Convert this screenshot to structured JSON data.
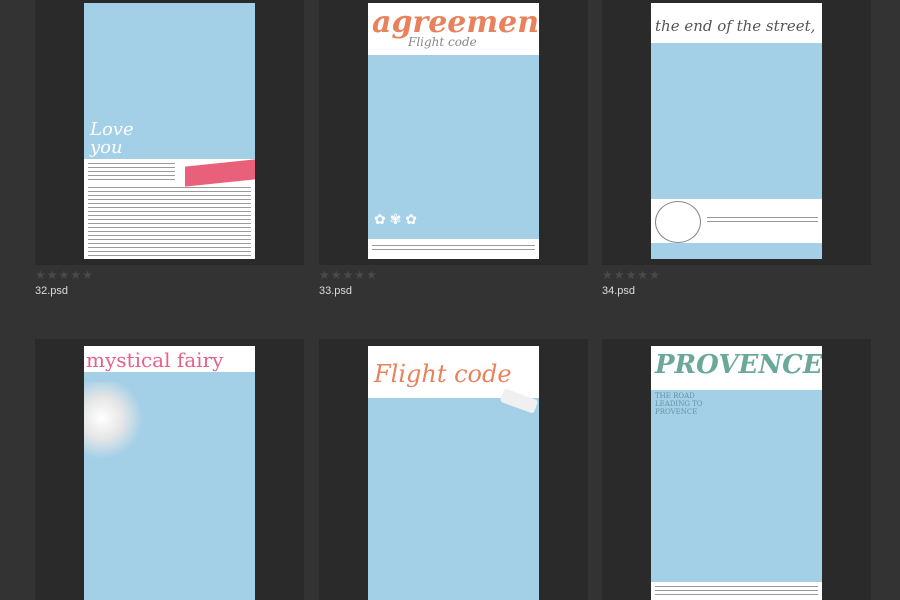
{
  "files": [
    {
      "name": "32.psd",
      "rating": 0
    },
    {
      "name": "33.psd",
      "rating": 0
    },
    {
      "name": "34.psd",
      "rating": 0
    },
    {
      "name": "",
      "rating": 0
    },
    {
      "name": "",
      "rating": 0
    },
    {
      "name": "",
      "rating": 0
    }
  ],
  "thumbnails": {
    "t32": {
      "title": "Love you",
      "banner_color": "#e8607a"
    },
    "t33": {
      "title": "agreement",
      "subtitle": "Flight code",
      "title_color": "#e8825c"
    },
    "t34": {
      "title": "the end of the street,",
      "title_color": "#555555"
    },
    "t35": {
      "title": "mystical fairy",
      "title_color": "#e8608a"
    },
    "t36": {
      "title": "Flight code",
      "title_color": "#e8825c"
    },
    "t37": {
      "title": "PROVENCE",
      "subtitle": "THE ROAD LEADING TO PROVENCE",
      "title_color": "#6aa89a"
    }
  },
  "colors": {
    "background": "#333333",
    "card": "#2a2a2a",
    "thumbnail_blue": "#a3cfe7",
    "star": "#4a4a4a",
    "filename": "#dcdcdc"
  }
}
